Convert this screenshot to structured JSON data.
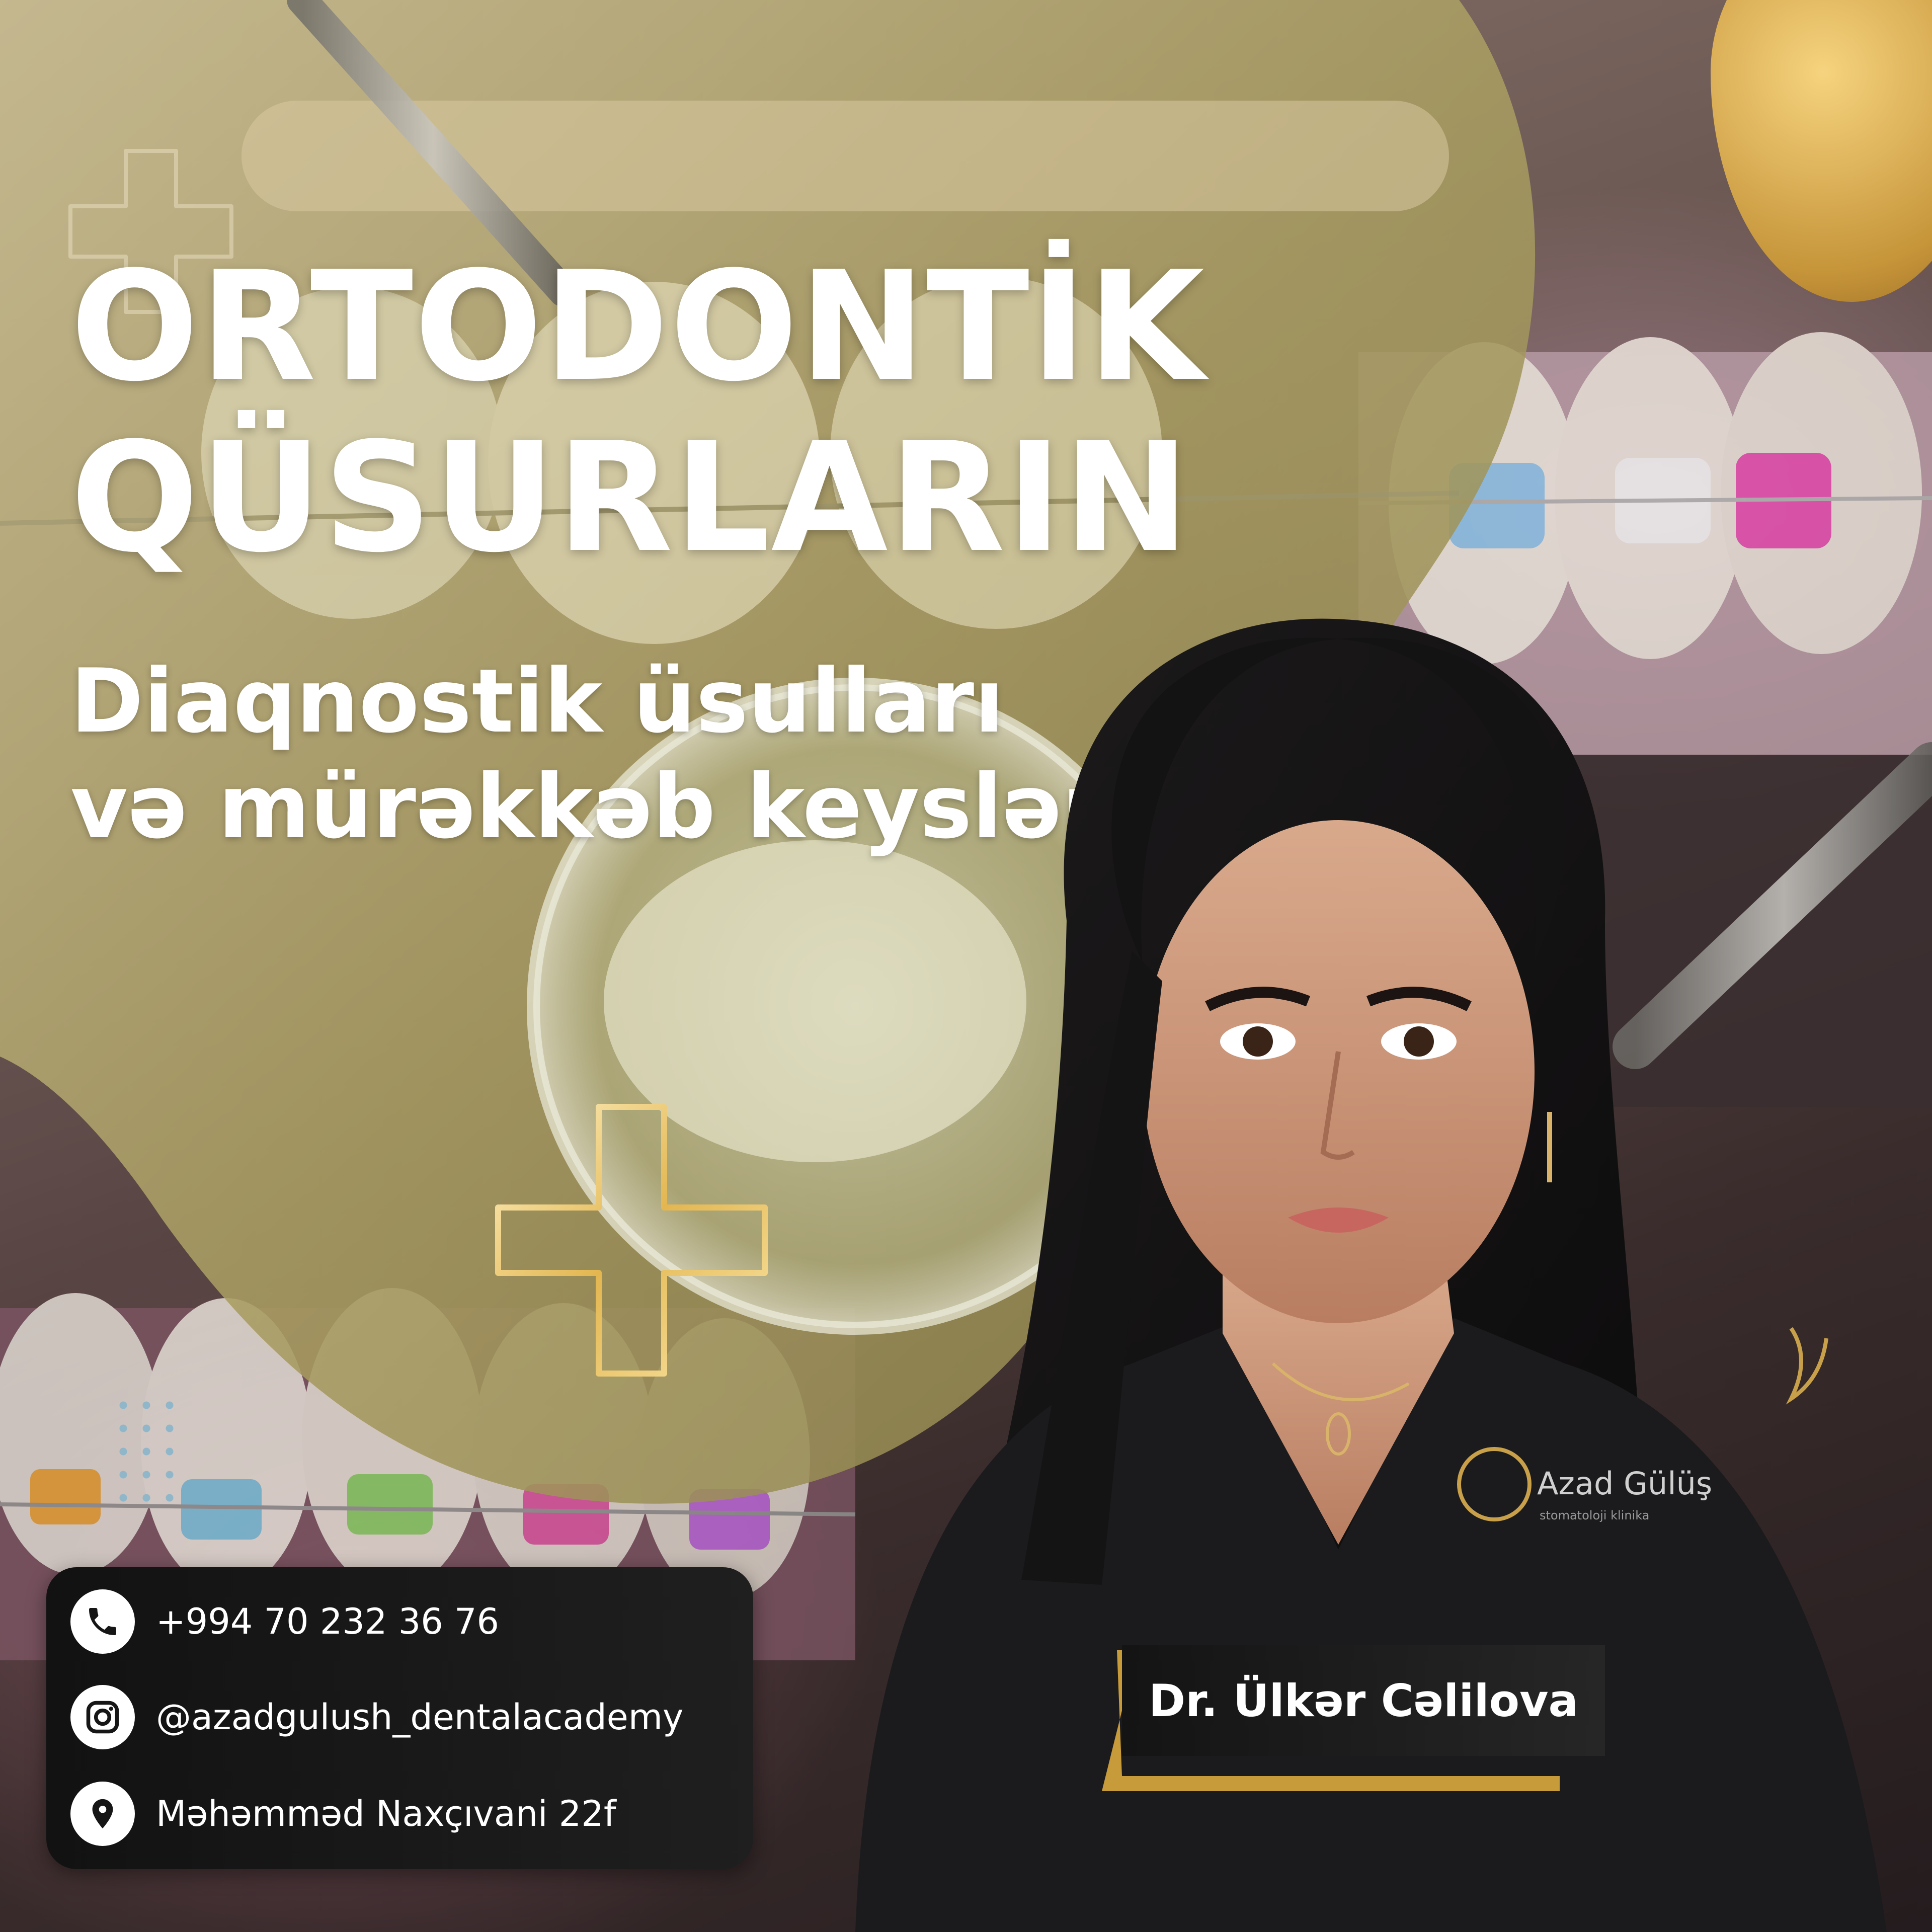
{
  "poster": {
    "title_line1": "ORTODONTİK",
    "title_line2": "QÜSURLARIN",
    "subtitle_line1": "Diaqnostik üsulları",
    "subtitle_line2": "və mürəkkəb keyslər",
    "doctor_name": "Dr. Ülkər Cəlilova",
    "clinic_logo_text": "Azad Gülüş",
    "clinic_logo_subtext": "stomatoloji klinika"
  },
  "contacts": [
    {
      "icon": "phone-icon",
      "text": "+994 70 232 36 76"
    },
    {
      "icon": "instagram-icon",
      "text": "@azadgulush_dentalacademy"
    },
    {
      "icon": "location-pin-icon",
      "text": "Məhəmməd Naxçıvani 22f"
    }
  ],
  "colors": {
    "accent_gold": "#d8a84a",
    "card_bg": "#151515",
    "text": "#ffffff",
    "scrub_black": "#1a1a1c"
  }
}
